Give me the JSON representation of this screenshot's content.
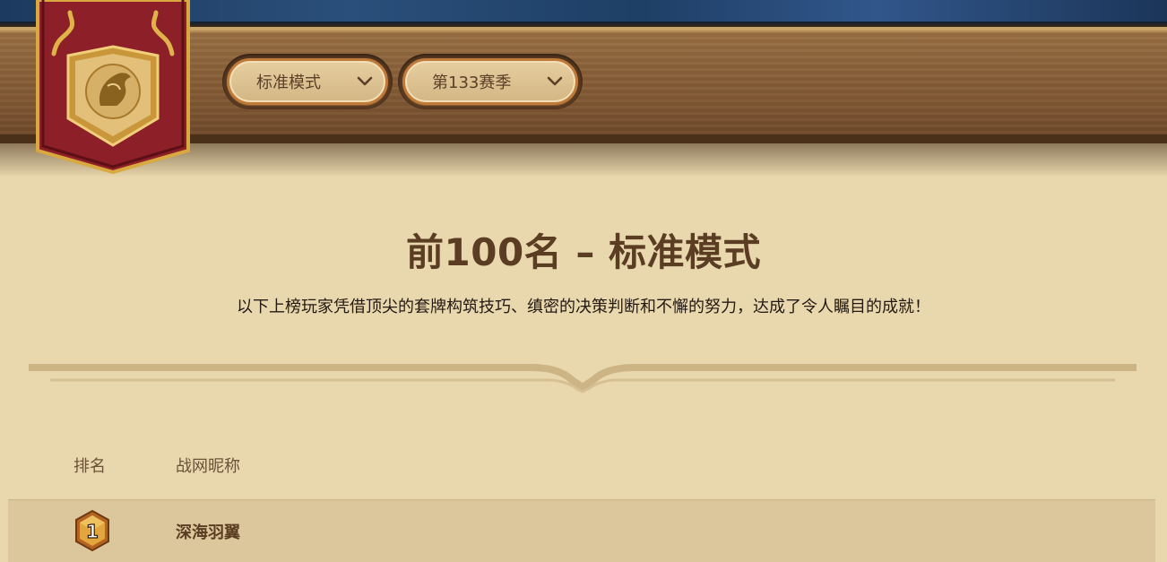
{
  "header": {
    "mode_dropdown": {
      "label": "标准模式"
    },
    "season_dropdown": {
      "label": "第133赛季"
    }
  },
  "main": {
    "title": "前100名 – 标准模式",
    "subtitle": "以下上榜玩家凭借顶尖的套牌构筑技巧、缜密的决策判断和不懈的努力，达成了令人瞩目的成就！"
  },
  "table": {
    "columns": [
      "排名",
      "战网昵称"
    ],
    "rows": [
      {
        "rank": "1",
        "name": "深海羽翼"
      }
    ]
  },
  "colors": {
    "background": "#e9d7ad",
    "banner_red": "#8c1f27",
    "gold": "#d9a93f",
    "text_brown": "#5a3d22"
  },
  "icons": {
    "banner": "hearthstone-horse-crest-icon",
    "dropdown": "chevron-down-icon",
    "rank": "rank-hexagon-icon"
  }
}
